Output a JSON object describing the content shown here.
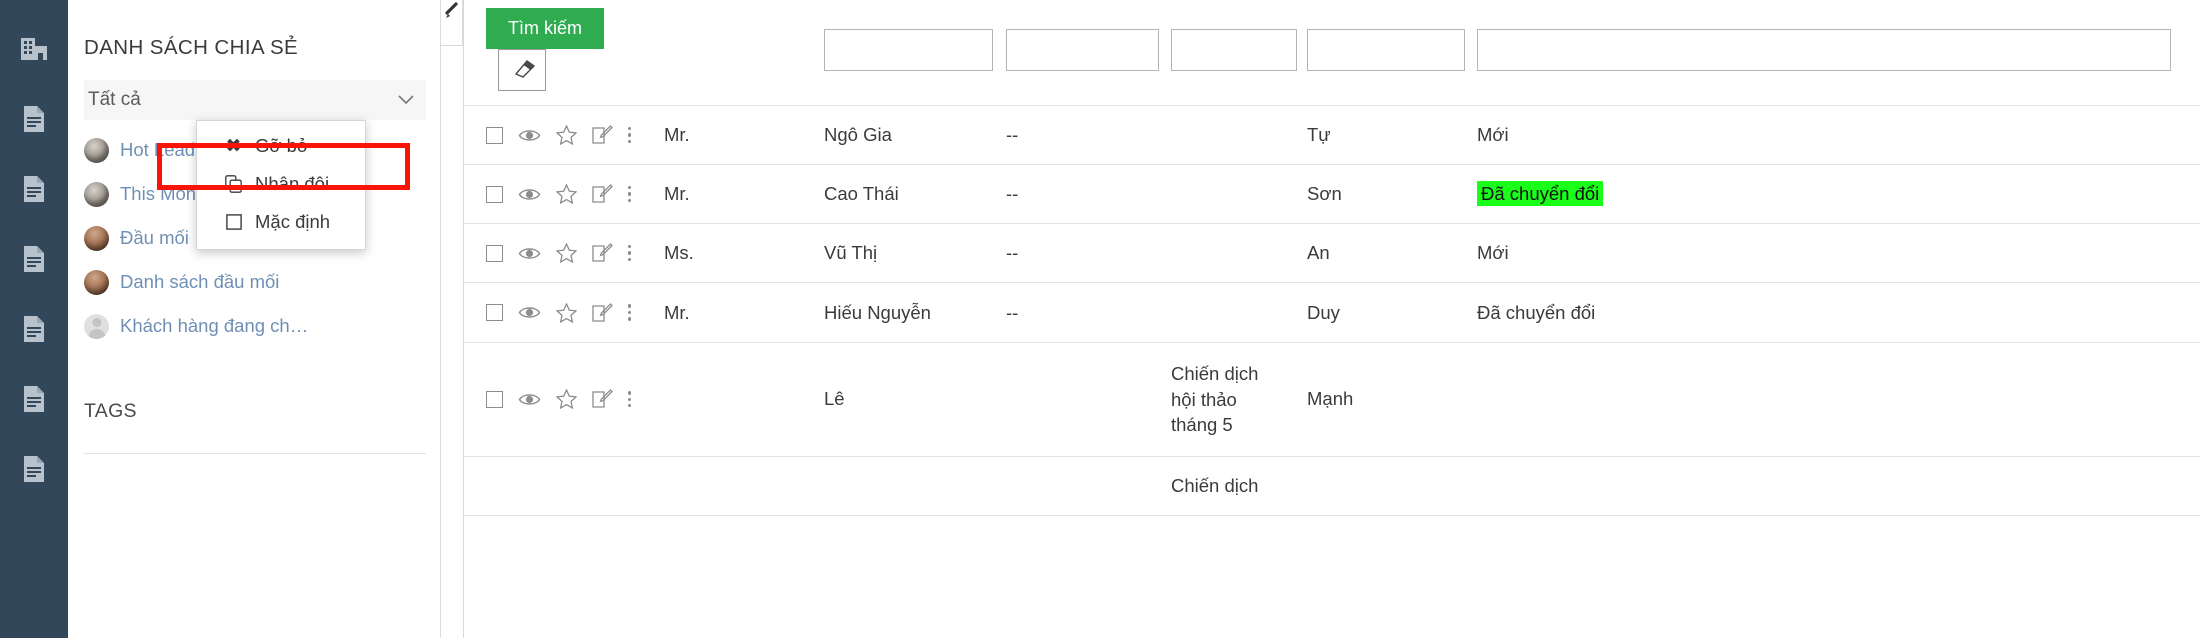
{
  "rail": {
    "items": [
      {
        "icon": "building-icon",
        "name": "rail-item-company"
      },
      {
        "icon": "document-icon",
        "name": "rail-item-doc-1"
      },
      {
        "icon": "document-icon",
        "name": "rail-item-doc-2"
      },
      {
        "icon": "document-icon",
        "name": "rail-item-doc-3"
      },
      {
        "icon": "document-icon",
        "name": "rail-item-doc-4"
      },
      {
        "icon": "document-icon",
        "name": "rail-item-doc-5"
      },
      {
        "icon": "document-icon",
        "name": "rail-item-doc-6"
      }
    ]
  },
  "share_panel": {
    "title": "DANH SÁCH CHIA SẺ",
    "filter_value": "Tất cả",
    "caret_icon": "chevron-down-icon",
    "items": [
      {
        "label": "Hot Leads",
        "avatar": "avatar-photo"
      },
      {
        "label": "This Month",
        "avatar": "avatar-photo"
      },
      {
        "label": "Đầu mối",
        "avatar": "avatar-photo"
      },
      {
        "label": "Danh sách đầu mối",
        "avatar": "avatar-photo"
      },
      {
        "label": "Khách hàng đang ch…",
        "avatar": "avatar-placeholder"
      }
    ],
    "tags_title": "TAGS"
  },
  "context_menu": {
    "items": [
      {
        "label": "Gỡ bỏ",
        "icon": "close-x-icon"
      },
      {
        "label": "Nhân đôi",
        "icon": "copy-icon"
      },
      {
        "label": "Mặc định",
        "icon": "checkbox-empty-icon"
      }
    ]
  },
  "toolbar": {
    "search_label": "Tìm kiếm",
    "eraser_icon": "eraser-icon",
    "search_color": "#2eac4f",
    "filters": [
      "",
      "",
      "",
      "",
      ""
    ]
  },
  "table": {
    "row_icons": {
      "checkbox": "checkbox-icon",
      "view": "eye-icon",
      "favorite": "star-icon",
      "edit": "edit-icon",
      "more": "more-vertical-icon"
    },
    "rows": [
      {
        "title": "Mr.",
        "name": "Ngô Gia",
        "dash": "--",
        "campaign": "",
        "owner": "Tự",
        "status": "Mới",
        "status_highlight": false
      },
      {
        "title": "Mr.",
        "name": "Cao Thái",
        "dash": "--",
        "campaign": "",
        "owner": "Sơn",
        "status": "Đã chuyển đổi",
        "status_highlight": true
      },
      {
        "title": "Ms.",
        "name": "Vũ Thị",
        "dash": "--",
        "campaign": "",
        "owner": "An",
        "status": "Mới",
        "status_highlight": false
      },
      {
        "title": "Mr.",
        "name": "Hiếu Nguyễn",
        "dash": "--",
        "campaign": "",
        "owner": "Duy",
        "status": "Đã chuyển đổi",
        "status_highlight": false
      },
      {
        "title": "",
        "name": "Lê",
        "dash": "",
        "campaign": "Chiến dịch hội thảo tháng 5",
        "owner": "Mạnh",
        "status": "",
        "status_highlight": false
      }
    ],
    "partial_row": {
      "campaign": "Chiến dịch"
    }
  },
  "colors": {
    "rail_bg": "#33475b",
    "search_green": "#2eac4f",
    "badge_green": "#19ff19",
    "link_blue": "#4a6fe3",
    "highlight_red": "#fa1405"
  }
}
